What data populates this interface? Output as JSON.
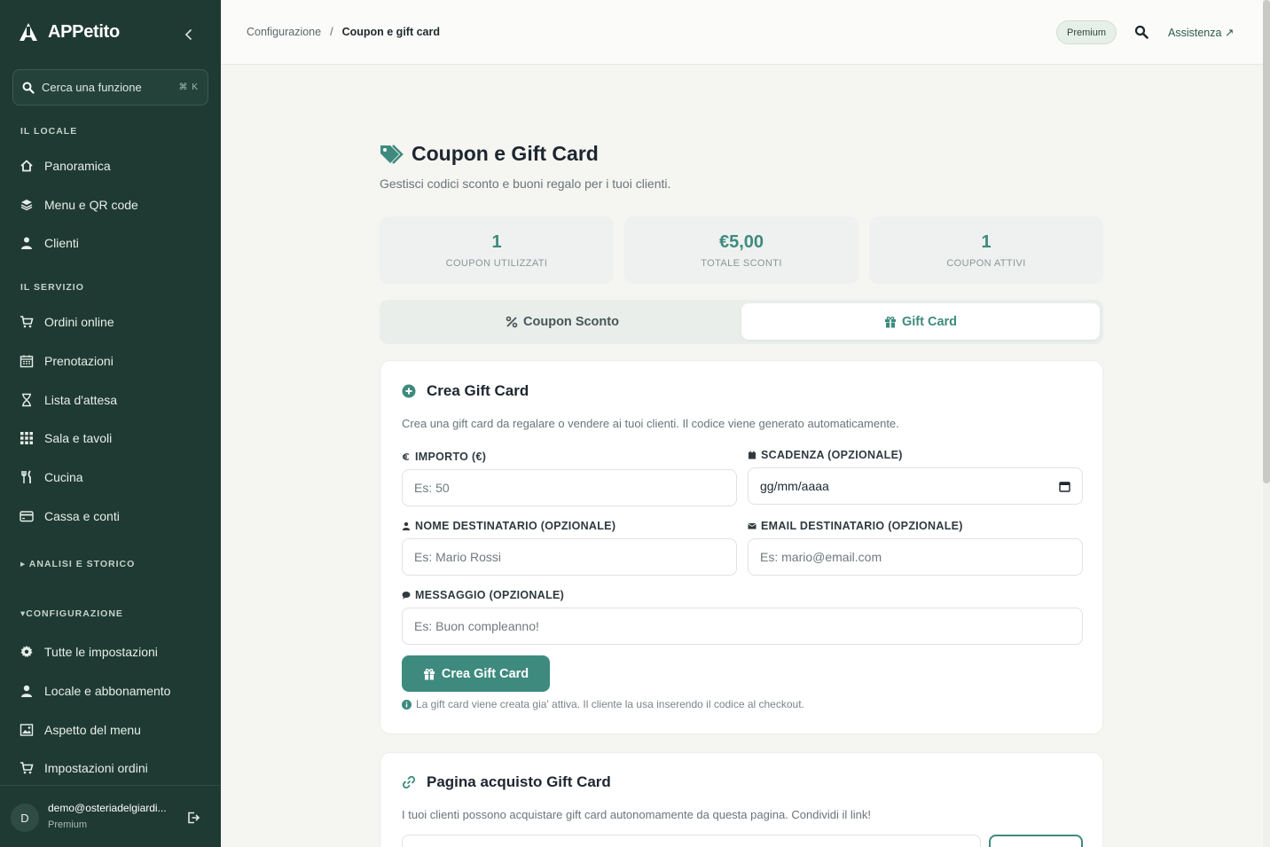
{
  "sidebar": {
    "brand": "APPetito",
    "search_placeholder": "Cerca una funzione",
    "search_shortcut": "⌘ K",
    "sections": {
      "locale": "IL LOCALE",
      "servizio": "IL SERVIZIO",
      "analisi": "▸ ANALISI E STORICO",
      "configurazione": "▾CONFIGURAZIONE"
    },
    "items": {
      "panoramica": "Panoramica",
      "menu_qr": "Menu e QR code",
      "clienti": "Clienti",
      "ordini_online": "Ordini online",
      "prenotazioni": "Prenotazioni",
      "lista_attesa": "Lista d'attesa",
      "sala_tavoli": "Sala e tavoli",
      "cucina": "Cucina",
      "cassa_conti": "Cassa e conti",
      "tutte_impostazioni": "Tutte le impostazioni",
      "locale_abbonamento": "Locale e abbonamento",
      "aspetto_menu": "Aspetto del menu",
      "impostazioni_ordini": "Impostazioni ordini"
    },
    "user": {
      "initial": "D",
      "email": "demo@osteriadelgiardi...",
      "plan": "Premium"
    }
  },
  "topbar": {
    "breadcrumb_parent": "Configurazione",
    "breadcrumb_sep": "/",
    "breadcrumb_current": "Coupon e gift card",
    "plan_badge": "Premium",
    "help_link": "Assistenza ↗"
  },
  "page": {
    "title": "Coupon e Gift Card",
    "subtitle": "Gestisci codici sconto e buoni regalo per i tuoi clienti."
  },
  "stats": [
    {
      "value": "1",
      "label": "COUPON UTILIZZATI"
    },
    {
      "value": "€5,00",
      "label": "TOTALE SCONTI"
    },
    {
      "value": "1",
      "label": "COUPON ATTIVI"
    }
  ],
  "tabs": {
    "coupon": "Coupon Sconto",
    "giftcard": "Gift Card",
    "active": "giftcard"
  },
  "create_card": {
    "title": "Crea Gift Card",
    "description": "Crea una gift card da regalare o vendere ai tuoi clienti. Il codice viene generato automaticamente.",
    "amount_label": "IMPORTO (€)",
    "amount_placeholder": "Es: 50",
    "expiry_label": "SCADENZA (OPZIONALE)",
    "expiry_value": "gg/mm/aaaa",
    "name_label": "NOME DESTINATARIO (OPZIONALE)",
    "name_placeholder": "Es: Mario Rossi",
    "email_label": "EMAIL DESTINATARIO (OPZIONALE)",
    "email_placeholder": "Es: mario@email.com",
    "message_label": "MESSAGGIO (OPZIONALE)",
    "message_placeholder": "Es: Buon compleanno!",
    "submit": "Crea Gift Card",
    "note": "La gift card viene creata gia' attiva. Il cliente la usa inserendo il codice al checkout."
  },
  "purchase_card": {
    "title": "Pagina acquisto Gift Card",
    "description": "I tuoi clienti possono acquistare gift card autonomamente da questa pagina. Condividi il link!"
  },
  "colors": {
    "sidebar_bg": "#1f3a32",
    "accent": "#3e8a7e",
    "page_bg": "#f5f5f1"
  }
}
